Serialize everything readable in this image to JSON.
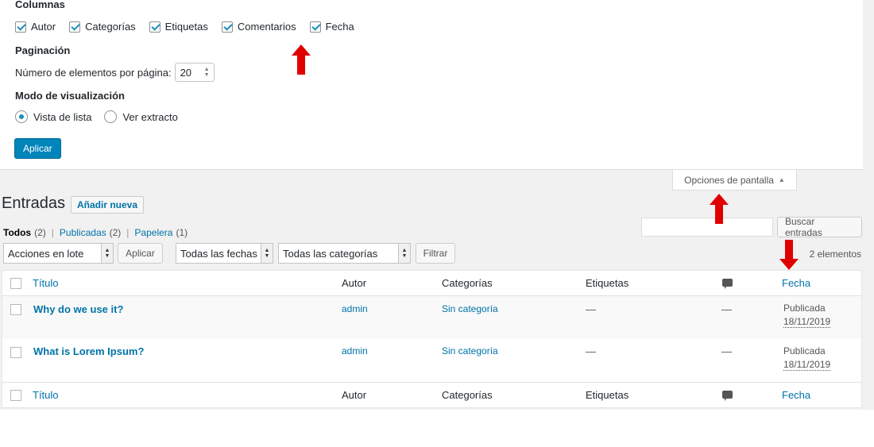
{
  "screen_options": {
    "columns_heading": "Columnas",
    "columns": [
      {
        "label": "Autor",
        "checked": true
      },
      {
        "label": "Categorías",
        "checked": true
      },
      {
        "label": "Etiquetas",
        "checked": true
      },
      {
        "label": "Comentarios",
        "checked": true
      },
      {
        "label": "Fecha",
        "checked": true
      }
    ],
    "pagination_heading": "Paginación",
    "per_page_label": "Número de elementos por página:",
    "per_page_value": "20",
    "view_mode_heading": "Modo de visualización",
    "view_modes": [
      {
        "label": "Vista de lista",
        "checked": true
      },
      {
        "label": "Ver extracto",
        "checked": false
      }
    ],
    "apply_label": "Aplicar",
    "tab_label": "Opciones de pantalla",
    "tab_icon": "triangle-up-icon"
  },
  "header": {
    "title": "Entradas",
    "add_new": "Añadir nueva"
  },
  "filters_links": [
    {
      "label": "Todos",
      "count": "(2)",
      "current": true
    },
    {
      "label": "Publicadas",
      "count": "(2)",
      "current": false
    },
    {
      "label": "Papelera",
      "count": "(1)",
      "current": false
    }
  ],
  "search": {
    "value": "",
    "button": "Buscar entradas"
  },
  "toolbar": {
    "bulk_action": "Acciones en lote",
    "apply": "Aplicar",
    "dates": "Todas las fechas",
    "categories": "Todas las categorías",
    "filter": "Filtrar",
    "count": "2 elementos"
  },
  "table": {
    "columns": {
      "title": "Título",
      "author": "Autor",
      "categories": "Categorías",
      "tags": "Etiquetas",
      "comments_icon": "comment-icon",
      "date": "Fecha"
    },
    "rows": [
      {
        "title": "Why do we use it?",
        "author": "admin",
        "category": "Sin categoría",
        "tags": "—",
        "comments": "—",
        "status": "Publicada",
        "date": "18/11/2019"
      },
      {
        "title": "What is Lorem Ipsum?",
        "author": "admin",
        "category": "Sin categoría",
        "tags": "—",
        "comments": "—",
        "status": "Publicada",
        "date": "18/11/2019"
      }
    ]
  },
  "colors": {
    "accent": "#0073aa",
    "primary_button": "#0085ba",
    "annotation_arrow": "#e00000"
  }
}
